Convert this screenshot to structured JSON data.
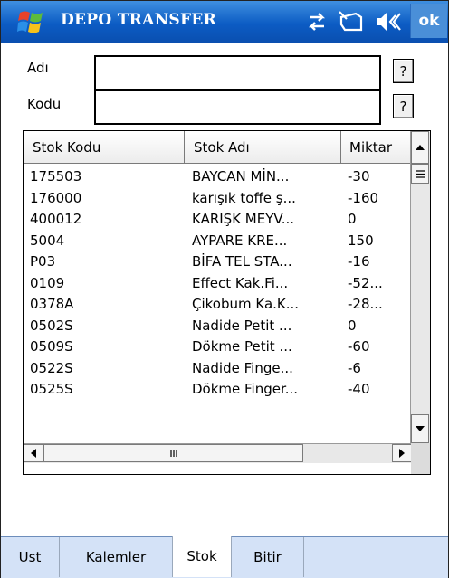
{
  "titlebar": {
    "title": "DEPO TRANSFER",
    "ok_label": "ok",
    "icons": [
      "connectivity-icon",
      "phone-icon",
      "volume-icon"
    ]
  },
  "form": {
    "adi_label": "Adı",
    "kodu_label": "Kodu",
    "adi_value": "",
    "kodu_value": "",
    "lookup_label": "?"
  },
  "list": {
    "columns": [
      "Stok Kodu",
      "Stok Adı",
      "Miktar"
    ],
    "rows": [
      {
        "code": "175503",
        "name": "BAYCAN MİN...",
        "qty": "-30"
      },
      {
        "code": "176000",
        "name": "karışık toffe ş...",
        "qty": "-160"
      },
      {
        "code": "400012",
        "name": "KARIŞK MEYV...",
        "qty": "0"
      },
      {
        "code": "5004",
        "name": "AYPARE KRE...",
        "qty": "150"
      },
      {
        "code": "P03",
        "name": "BİFA TEL STA...",
        "qty": "-16"
      },
      {
        "code": "0109",
        "name": "Effect Kak.Fi...",
        "qty": "-52..."
      },
      {
        "code": "0378A",
        "name": "Çikobum Ka.K...",
        "qty": "-28..."
      },
      {
        "code": "0502S",
        "name": "Nadide Petit ...",
        "qty": "0"
      },
      {
        "code": "0509S",
        "name": "Dökme Petit ...",
        "qty": "-60"
      },
      {
        "code": "0522S",
        "name": "Nadide Finge...",
        "qty": "-6"
      },
      {
        "code": "0525S",
        "name": "Dökme Finger...",
        "qty": "-40"
      }
    ]
  },
  "tabs": [
    {
      "label": "Ust",
      "active": false
    },
    {
      "label": "Kalemler",
      "active": false
    },
    {
      "label": "Stok",
      "active": true
    },
    {
      "label": "Bitir",
      "active": false
    }
  ]
}
